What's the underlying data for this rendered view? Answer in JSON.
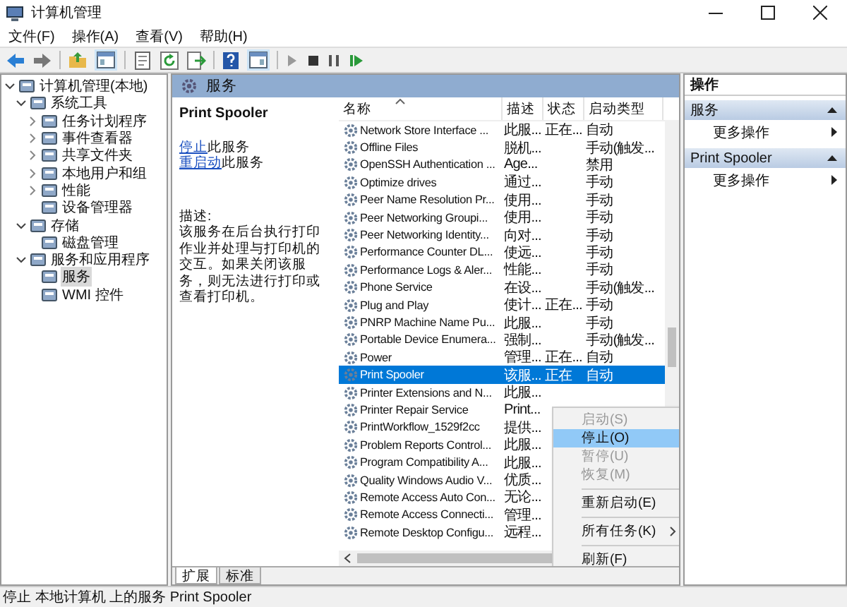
{
  "window": {
    "title": "计算机管理"
  },
  "menu": [
    "文件(F)",
    "操作(A)",
    "查看(V)",
    "帮助(H)"
  ],
  "tree": [
    {
      "label": "计算机管理(本地)",
      "expanded": true,
      "selected": false,
      "children": [
        {
          "label": "系统工具",
          "expanded": true,
          "selected": false,
          "children": [
            {
              "label": "任务计划程序",
              "expanded": false,
              "selected": false
            },
            {
              "label": "事件查看器",
              "expanded": false,
              "selected": false
            },
            {
              "label": "共享文件夹",
              "expanded": false,
              "selected": false
            },
            {
              "label": "本地用户和组",
              "expanded": false,
              "selected": false
            },
            {
              "label": "性能",
              "expanded": false,
              "selected": false
            },
            {
              "label": "设备管理器",
              "selected": false
            }
          ]
        },
        {
          "label": "存储",
          "expanded": true,
          "selected": false,
          "children": [
            {
              "label": "磁盘管理",
              "selected": false
            }
          ]
        },
        {
          "label": "服务和应用程序",
          "expanded": true,
          "selected": false,
          "children": [
            {
              "label": "服务",
              "selected": true
            },
            {
              "label": "WMI 控件",
              "selected": false
            }
          ]
        }
      ]
    }
  ],
  "panel_header": "服务",
  "detail": {
    "service_name": "Print Spooler",
    "links": [
      {
        "link": "停止",
        "text": "此服务"
      },
      {
        "link": "重启动",
        "text": "此服务"
      }
    ],
    "description_label": "描述:",
    "description": "该服务在后台执行打印作业并处理与打印机的交互。如果关闭该服务，则无法进行打印或查看打印机。"
  },
  "table": {
    "columns": [
      "名称",
      "描述",
      "状态",
      "启动类型"
    ],
    "rows": [
      {
        "name": "Network Store Interface ...",
        "description": "此服...",
        "status": "正在...",
        "startup": "自动",
        "selected": false
      },
      {
        "name": "Offline Files",
        "description": "脱机...",
        "status": "",
        "startup": "手动(触发...",
        "selected": false
      },
      {
        "name": "OpenSSH Authentication ...",
        "description": "Age...",
        "status": "",
        "startup": "禁用",
        "selected": false
      },
      {
        "name": "Optimize drives",
        "description": "通过...",
        "status": "",
        "startup": "手动",
        "selected": false
      },
      {
        "name": "Peer Name Resolution Pr...",
        "description": "使用...",
        "status": "",
        "startup": "手动",
        "selected": false
      },
      {
        "name": "Peer Networking Groupi...",
        "description": "使用...",
        "status": "",
        "startup": "手动",
        "selected": false
      },
      {
        "name": "Peer Networking Identity...",
        "description": "向对...",
        "status": "",
        "startup": "手动",
        "selected": false
      },
      {
        "name": "Performance Counter DL...",
        "description": "使远...",
        "status": "",
        "startup": "手动",
        "selected": false
      },
      {
        "name": "Performance Logs & Aler...",
        "description": "性能...",
        "status": "",
        "startup": "手动",
        "selected": false
      },
      {
        "name": "Phone Service",
        "description": "在设...",
        "status": "",
        "startup": "手动(触发...",
        "selected": false
      },
      {
        "name": "Plug and Play",
        "description": "使计...",
        "status": "正在...",
        "startup": "手动",
        "selected": false
      },
      {
        "name": "PNRP Machine Name Pu...",
        "description": "此服...",
        "status": "",
        "startup": "手动",
        "selected": false
      },
      {
        "name": "Portable Device Enumera...",
        "description": "强制...",
        "status": "",
        "startup": "手动(触发...",
        "selected": false
      },
      {
        "name": "Power",
        "description": "管理...",
        "status": "正在...",
        "startup": "自动",
        "selected": false
      },
      {
        "name": "Print Spooler",
        "description": "该服...",
        "status": "正在",
        "startup": "自动",
        "selected": true
      },
      {
        "name": "Printer Extensions and N...",
        "description": "此服...",
        "selected": false
      },
      {
        "name": "Printer Repair Service",
        "description": "Print...",
        "selected": false
      },
      {
        "name": "PrintWorkflow_1529f2cc",
        "description": "提供...",
        "selected": false
      },
      {
        "name": "Problem Reports Control...",
        "description": "此服...",
        "selected": false
      },
      {
        "name": "Program Compatibility A...",
        "description": "此服...",
        "selected": false
      },
      {
        "name": "Quality Windows Audio V...",
        "description": "优质...",
        "selected": false
      },
      {
        "name": "Remote Access Auto Con...",
        "description": "无论...",
        "selected": false
      },
      {
        "name": "Remote Access Connecti...",
        "description": "管理...",
        "selected": false
      },
      {
        "name": "Remote Desktop Configu...",
        "description": "远程...",
        "selected": false
      }
    ]
  },
  "view_tabs": [
    {
      "label": "扩展",
      "selected": true
    },
    {
      "label": "标准",
      "selected": false
    }
  ],
  "context_menu": [
    {
      "kind": "item",
      "label": "启动(S)",
      "disabled": true,
      "selected": false
    },
    {
      "kind": "item",
      "label": "停止(O)",
      "disabled": false,
      "selected": true
    },
    {
      "kind": "item",
      "label": "暂停(U)",
      "disabled": true,
      "selected": false
    },
    {
      "kind": "item",
      "label": "恢复(M)",
      "disabled": true,
      "selected": false
    },
    {
      "kind": "separator"
    },
    {
      "kind": "item",
      "label": "重新启动(E)",
      "disabled": false,
      "selected": false
    },
    {
      "kind": "separator"
    },
    {
      "kind": "submenu",
      "label": "所有任务(K)",
      "disabled": false,
      "selected": false
    },
    {
      "kind": "separator"
    },
    {
      "kind": "item",
      "label": "刷新(F)",
      "disabled": false,
      "selected": false
    }
  ],
  "actions": {
    "title": "操作",
    "sections": [
      {
        "title": "服务",
        "items": [
          "更多操作"
        ]
      },
      {
        "title": "Print Spooler",
        "items": [
          "更多操作"
        ]
      }
    ]
  },
  "status_bar": "停止 本地计算机 上的服务 Print Spooler"
}
